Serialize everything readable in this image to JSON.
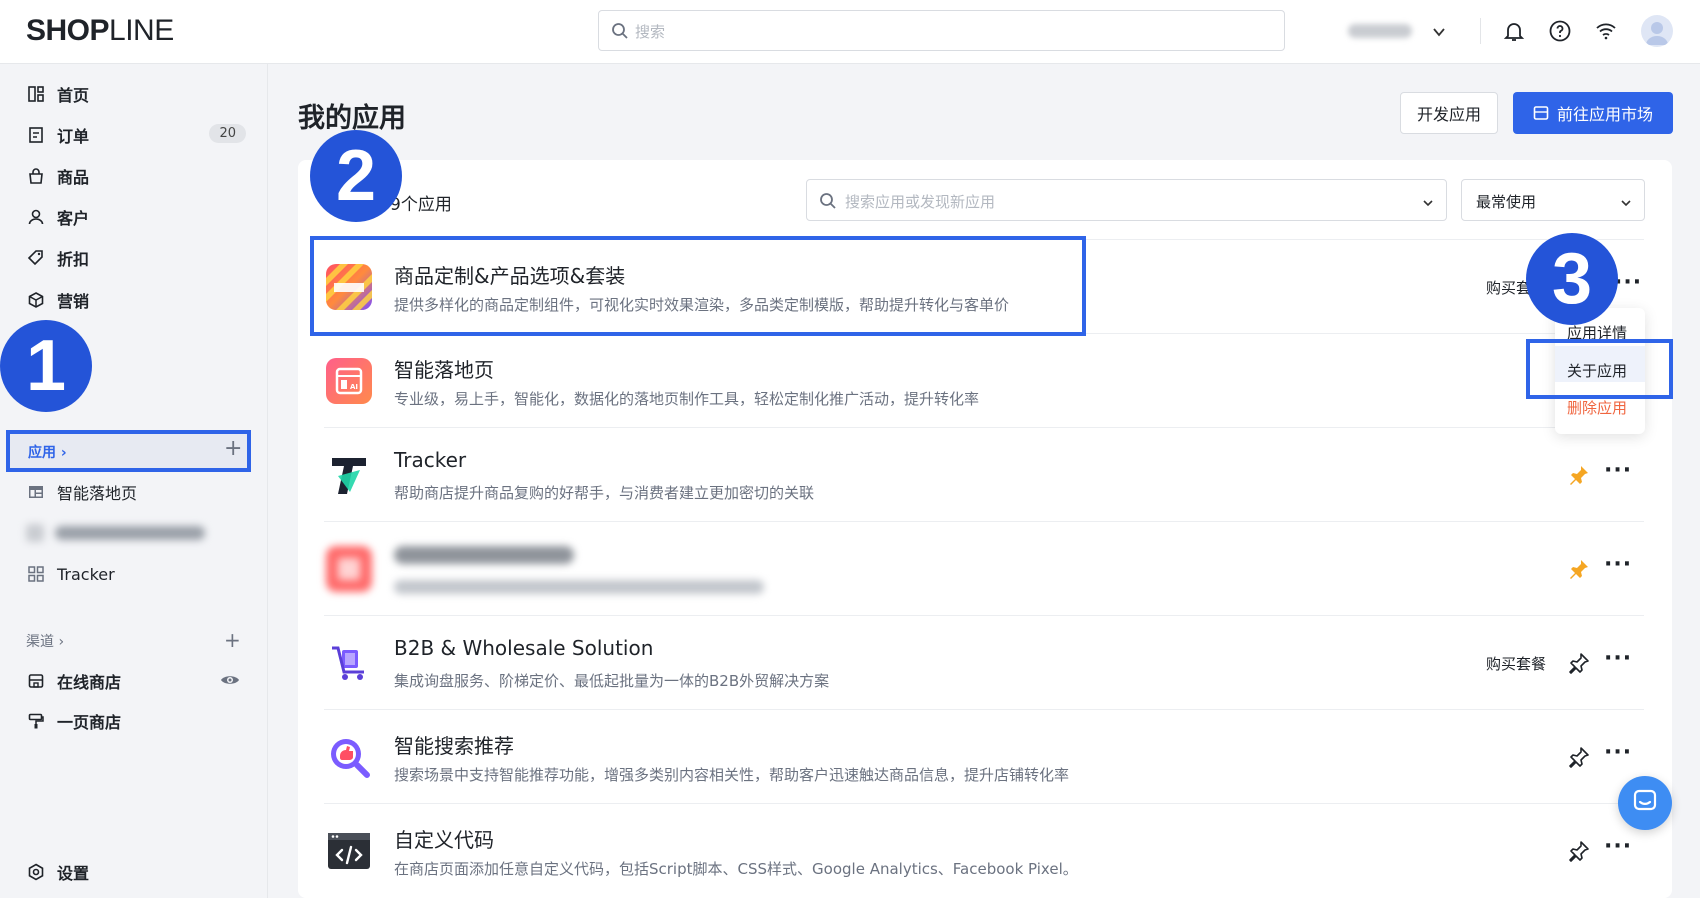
{
  "header": {
    "logo_bold": "SHOP",
    "logo_thin": "LINE",
    "search_placeholder": "搜索"
  },
  "sidebar": {
    "items": [
      {
        "label": "首页"
      },
      {
        "label": "订单",
        "badge": "20"
      },
      {
        "label": "商品"
      },
      {
        "label": "客户"
      },
      {
        "label": "折扣"
      },
      {
        "label": "营销"
      }
    ],
    "apps_section": {
      "label": "应用 ›"
    },
    "app_items": [
      {
        "label": "智能落地页"
      },
      {
        "label": "Tracker"
      }
    ],
    "channels_section": {
      "label": "渠道 ›"
    },
    "channel_items": [
      {
        "label": "在线商店"
      },
      {
        "label": "一页商店"
      }
    ],
    "settings_label": "设置"
  },
  "main": {
    "title": "我的应用",
    "dev_button": "开发应用",
    "market_button": "前往应用市场",
    "count_label": "9个应用",
    "app_search_placeholder": "搜索应用或发现新应用",
    "sort_value": "最常使用",
    "apps": [
      {
        "name": "商品定制&产品选项&套装",
        "desc": "提供多样化的商品定制组件，可视化实时效果渲染，多品类定制模版，帮助提升转化与客单价",
        "buy": "购买套餐"
      },
      {
        "name": "智能落地页",
        "desc": "专业级，易上手，智能化，数据化的落地页制作工具，轻松定制化推广活动，提升转化率"
      },
      {
        "name": "Tracker",
        "desc": "帮助商店提升商品复购的好帮手，与消费者建立更加密切的关联"
      },
      {
        "name": "",
        "desc": ""
      },
      {
        "name": "B2B & Wholesale Solution",
        "desc": "集成询盘服务、阶梯定价、最低起批量为一体的B2B外贸解决方案",
        "buy": "购买套餐"
      },
      {
        "name": "智能搜索推荐",
        "desc": "搜索场景中支持智能推荐功能，增强多类别内容相关性，帮助客户迅速触达商品信息，提升店铺转化率"
      },
      {
        "name": "自定义代码",
        "desc": "在商店页面添加任意自定义代码，包括Script脚本、CSS样式、Google Analytics、Facebook Pixel。"
      }
    ],
    "more_label": "···"
  },
  "dropdown": {
    "details": "应用详情",
    "about": "关于应用",
    "delete": "删除应用"
  },
  "annotations": [
    "1",
    "2",
    "3"
  ],
  "colors": {
    "accent": "#2f64e8",
    "pin_active": "#f5a623",
    "danger": "#f0653f"
  }
}
